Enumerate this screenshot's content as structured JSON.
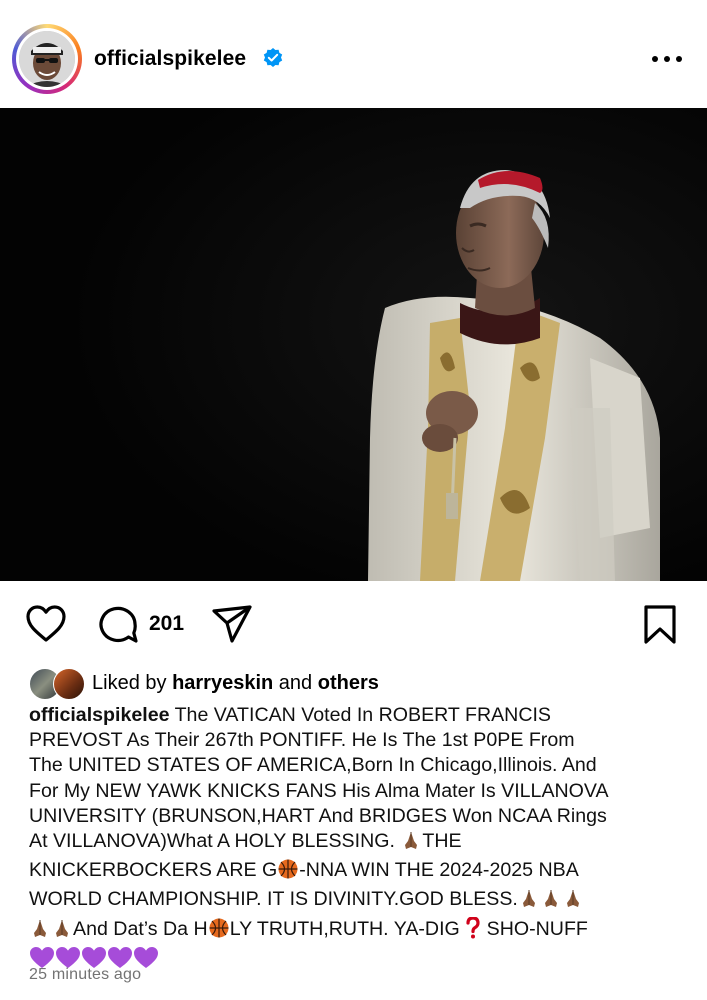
{
  "header": {
    "username": "officialspikelee",
    "avatar_icon": "profile-avatar",
    "verified_icon": "verified-badge-icon",
    "more_icon": "more-options-icon"
  },
  "post": {
    "image_icon": "post-photo"
  },
  "actions": {
    "like_icon": "heart-icon",
    "comment_icon": "comment-icon",
    "comment_count": "201",
    "share_icon": "paper-plane-icon",
    "save_icon": "bookmark-icon"
  },
  "likes": {
    "prefix": "Liked by",
    "user": "harryeskin",
    "middle": "and",
    "others": "others"
  },
  "caption": {
    "username": "officialspikelee",
    "line1": "The VATICAN Voted In ROBERT FRANCIS",
    "line2": "PREVOST As Their 267th PONTIFF. He Is The 1st P0PE From",
    "line3": "The UNITED STATES OF AMERICA,Born In Chicago,Illinois. And",
    "line4": "For My NEW YAWK KNICKS FANS His Alma Mater Is VILLANOVA",
    "line5": "UNIVERSITY (BRUNSON,HART And BRIDGES Won NCAA Rings",
    "line6": "At VILLANOVA)What A HOLY BLESSING.",
    "line7a": "THE",
    "line8a": "KNICKERBOCKERS ARE G",
    "line8b": "-NNA WIN THE 2024-2025 NBA",
    "line9": "WORLD CHAMPIONSHIP. IT IS DIVINITY.GOD BLESS.",
    "line10a": "And Dat’s Da H",
    "line10b": "LY TRUTH,RUTH. YA-DIG",
    "line10c": "SHO-NUFF",
    "emoji_pray": "folded-hands-emoji",
    "emoji_ball": "basketball-emoji",
    "emoji_question": "red-question-mark-emoji",
    "emoji_heart": "purple-heart-emoji"
  },
  "timestamp": "25 minutes ago",
  "colors": {
    "verified_blue": "#0095f6",
    "timestamp_gray": "#737373",
    "heart_purple": "#a64cd9",
    "basketball_orange": "#e66a1e",
    "cardinal_red": "#b5192b"
  }
}
